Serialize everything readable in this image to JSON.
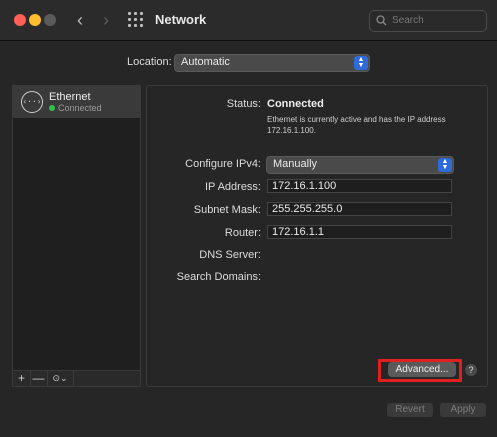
{
  "window": {
    "title": "Network"
  },
  "search": {
    "placeholder": "Search"
  },
  "location": {
    "label": "Location:",
    "value": "Automatic"
  },
  "sidebar": {
    "items": [
      {
        "name": "Ethernet",
        "status": "Connected",
        "icon": "ethernet-icon",
        "status_color": "#32c14a"
      }
    ],
    "footer": {
      "add": "+",
      "remove": "—",
      "action": "⊙⌄"
    }
  },
  "details": {
    "status_label": "Status:",
    "status_value": "Connected",
    "status_description": "Ethernet is currently active and has the IP address 172.16.1.100.",
    "configure_label": "Configure IPv4:",
    "configure_value": "Manually",
    "ip_label": "IP Address:",
    "ip_value": "172.16.1.100",
    "subnet_label": "Subnet Mask:",
    "subnet_value": "255.255.255.0",
    "router_label": "Router:",
    "router_value": "172.16.1.1",
    "dns_label": "DNS Server:",
    "search_domains_label": "Search Domains:",
    "advanced_label": "Advanced...",
    "help_label": "?"
  },
  "buttons": {
    "revert": "Revert",
    "apply": "Apply"
  },
  "colors": {
    "accent": "#2f6ad9",
    "highlight": "#e02020"
  }
}
